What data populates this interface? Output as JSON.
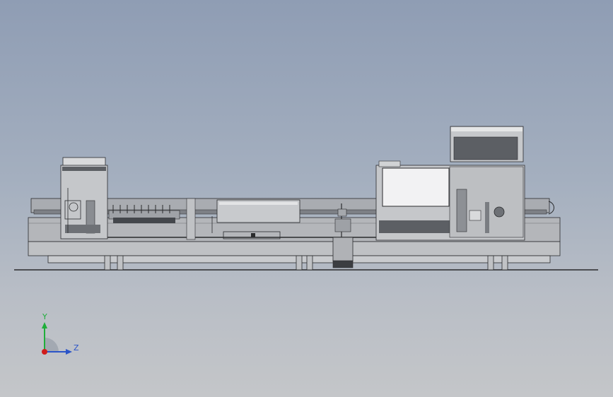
{
  "view": {
    "background_top": "#8f9db4",
    "background_bottom": "#c4c6c9"
  },
  "model": {
    "machine_body": "#b4b6ba",
    "dark_gray": "#5c5f64",
    "light_panel": "#d9dadc",
    "outline": "#2a2b2d"
  },
  "triad": {
    "y_label": "Y",
    "z_label": "Z",
    "y_color": "#1fae3a",
    "z_color": "#2b54c8",
    "x_color": "#d01c1c"
  }
}
